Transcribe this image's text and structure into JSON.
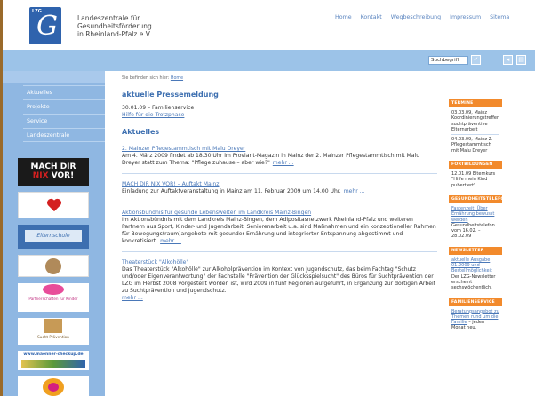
{
  "header": {
    "logo_text": "LZG",
    "logo_letter": "G",
    "org_lines": [
      "Landeszentrale für",
      "Gesundheitsförderung",
      "in Rheinland-Pfalz e.V."
    ],
    "topnav": [
      "Home",
      "Kontakt",
      "Wegbeschreibung",
      "Impressum",
      "Sitema"
    ]
  },
  "search": {
    "value": "Suchbegriff"
  },
  "sidebar": {
    "nav": [
      "Aktuelles",
      "Projekte",
      "Service",
      "Landeszentrale"
    ],
    "banners": {
      "b1_line1": "MACH DIR",
      "b1_line2a": "NIX",
      "b1_line2b": " VOR!",
      "b3_text": "Elternschule",
      "b5_text": "Partnerschaften für Kinder",
      "b6_text": "Sucht Prävention",
      "b7_text": "www.maenner-checkup.de"
    }
  },
  "main": {
    "breadcrumb_prefix": "Sie befinden sich hier:",
    "breadcrumb_home": "Home",
    "press_heading": "aktuelle Pressemeldung",
    "press_date": "30.01.09 – Familienservice",
    "press_link": "Hilfe für die Trotzphase",
    "aktuelles_heading": "Aktuelles",
    "more_label": "mehr ...",
    "news": [
      {
        "title": "2. Mainzer Pflegestammtisch mit Malu Dreyer",
        "text": "Am 4. März 2009 findet ab 18.30 Uhr im Proviant-Magazin in Mainz der 2. Mainzer Pflegestammtisch mit Malu Dreyer statt zum Thema: \"Pflege zuhause – aber wie?\""
      },
      {
        "title": "MACH DIR NIX VOR! – Auftakt Mainz",
        "text": "Einladung zur Auftaktveranstaltung in Mainz am 11. Februar 2009 um 14.00 Uhr."
      },
      {
        "title": "Aktionsbündnis für gesunde Lebenswelten im Landkreis Mainz-Bingen",
        "text": "Im Aktionsbündnis mit dem Landkreis Mainz-Bingen, dem Adipositasnetzwerk Rheinland-Pfalz und weiteren Partnern aus Sport, Kinder- und Jugendarbeit, Seniorenarbeit u.a. sind Maßnahmen und ein konzeptioneller Rahmen für Bewegungs(raum)angebote mit gesunder Ernährung und integrierter Entspannung abgestimmt und konkretisiert."
      },
      {
        "title": "Theaterstück \"Alkohölle\"",
        "text": "Das Theaterstück \"Alkohölle\" zur Alkoholprävention im Kontext von Jugendschutz, das beim Fachtag \"Schutz und/oder Eigenverantwortung\" der Fachstelle \"Prävention der Glücksspielsucht\" des Büros für Suchtprävention der LZG im Herbst 2008 vorgestellt worden ist, wird 2009 in fünf Regionen aufgeführt, in Ergänzung zur dortigen Arbeit zu Suchtprävention und Jugendschutz."
      }
    ]
  },
  "right": {
    "termine": {
      "head": "TERMINE",
      "items": [
        "03.03.09, Mainz Koordinierungstreffen suchtpräventive Elternarbeit",
        "04.03.09, Mainz 2. Pflegestammtisch mit Malu Dreyer"
      ]
    },
    "fortbildungen": {
      "head": "FORTBILDUNGEN",
      "text": "12.01.09 Elternkurs \"Hilfe mein Kind pubertiert\""
    },
    "gesundheitstelefon": {
      "head": "GESUNDHEITSTELEFON",
      "link": "Fastenzeit: Über Ernährung bewusst werden",
      "text": "Gesundheitstelefon vom 16.02. – 28.02.09"
    },
    "newsletter": {
      "head": "NEWSLETTER",
      "link": "aktuelle Ausgabe 01.2009 und Bestellmöglichkeit",
      "text": "Der LZG-Newsletter erscheint sechswöchentlich."
    },
    "familienservice": {
      "head": "FAMILIENSERVICE",
      "link": "Beratungsangebot zu Themen rund um die Familie",
      "text": "– jeden Monat neu."
    }
  }
}
